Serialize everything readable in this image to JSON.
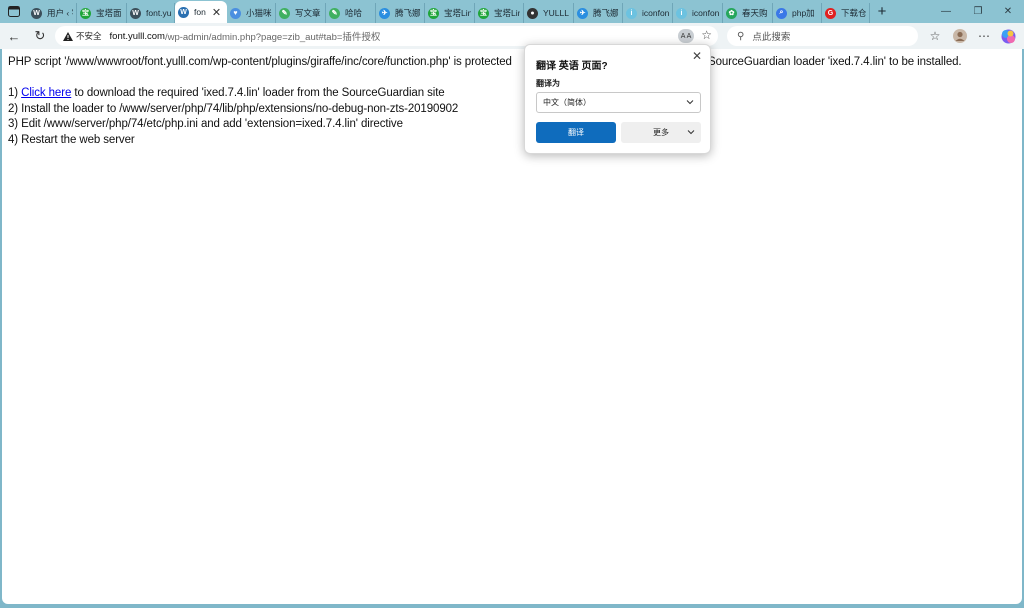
{
  "colors": {
    "tabstrip": "#8cc3d2",
    "toolbar": "#eef3f5",
    "link": "#0000ee",
    "primary_button": "#0f6cbd"
  },
  "tabs": [
    {
      "label": "用户 ‹ 字",
      "icon": "wordpress-icon",
      "fav_color": "#3c4f5a",
      "active": false
    },
    {
      "label": "宝塔面",
      "icon": "baota-icon",
      "fav_color": "#20a53a",
      "active": false
    },
    {
      "label": "font.yu",
      "icon": "wordpress-icon",
      "fav_color": "#3c4f5a",
      "active": false
    },
    {
      "label": "fon",
      "icon": "wordpress-icon",
      "fav_color": "#2a6fb0",
      "active": true
    },
    {
      "label": "小猫咪",
      "icon": "heart-icon",
      "fav_color": "#4b8fe0",
      "active": false
    },
    {
      "label": "写文章",
      "icon": "doc-icon",
      "fav_color": "#40b060",
      "active": false
    },
    {
      "label": "哈哈",
      "icon": "doc-icon",
      "fav_color": "#40b060",
      "active": false
    },
    {
      "label": "腾飞娜",
      "icon": "bird-icon",
      "fav_color": "#2a8ee0",
      "active": false
    },
    {
      "label": "宝塔Lin",
      "icon": "baota-icon",
      "fav_color": "#20a53a",
      "active": false
    },
    {
      "label": "宝塔Lin",
      "icon": "baota-icon",
      "fav_color": "#20a53a",
      "active": false
    },
    {
      "label": "YULLL·",
      "icon": "github-icon",
      "fav_color": "#333333",
      "active": false
    },
    {
      "label": "腾飞娜",
      "icon": "bird-icon",
      "fav_color": "#2a8ee0",
      "active": false
    },
    {
      "label": "iconfon",
      "icon": "iconfont-icon",
      "fav_color": "#6cc2e0",
      "active": false
    },
    {
      "label": "iconfon",
      "icon": "iconfont-icon",
      "fav_color": "#6cc2e0",
      "active": false
    },
    {
      "label": "春天购",
      "icon": "spring-icon",
      "fav_color": "#26a65b",
      "active": false
    },
    {
      "label": "php加",
      "icon": "search-icon",
      "fav_color": "#3b78e7",
      "active": false
    },
    {
      "label": "下载仓",
      "icon": "download-site-icon",
      "fav_color": "#e02020",
      "active": false
    }
  ],
  "toolbar": {
    "security_label": "不安全",
    "url_domain": "font.yulll.com",
    "url_path": "/wp-admin/admin.php?page=zib_aut#tab=插件授权",
    "reader_badge": "A A",
    "search_placeholder": "点此搜索"
  },
  "page": {
    "error_text_1": "PHP script '/www/wwwroot/font.yulll.com/wp-content/plugins/giraffe/inc/core/function.php' is protected",
    "error_text_2": "SourceGuardian loader 'ixed.7.4.lin' to be installed.",
    "step1_prefix": "1) ",
    "step1_link": "Click here",
    "step1_suffix": " to download the required 'ixed.7.4.lin' loader from the SourceGuardian site",
    "step2": "2) Install the loader to /www/server/php/74/lib/php/extensions/no-debug-non-zts-20190902",
    "step3": "3) Edit /www/server/php/74/etc/php.ini and add 'extension=ixed.7.4.lin' directive",
    "step4": "4) Restart the web server"
  },
  "translate_popup": {
    "title": "翻译 英语 页面?",
    "subtitle": "翻译为",
    "target_language": "中文（简体）",
    "translate_button": "翻译",
    "more_button": "更多"
  }
}
